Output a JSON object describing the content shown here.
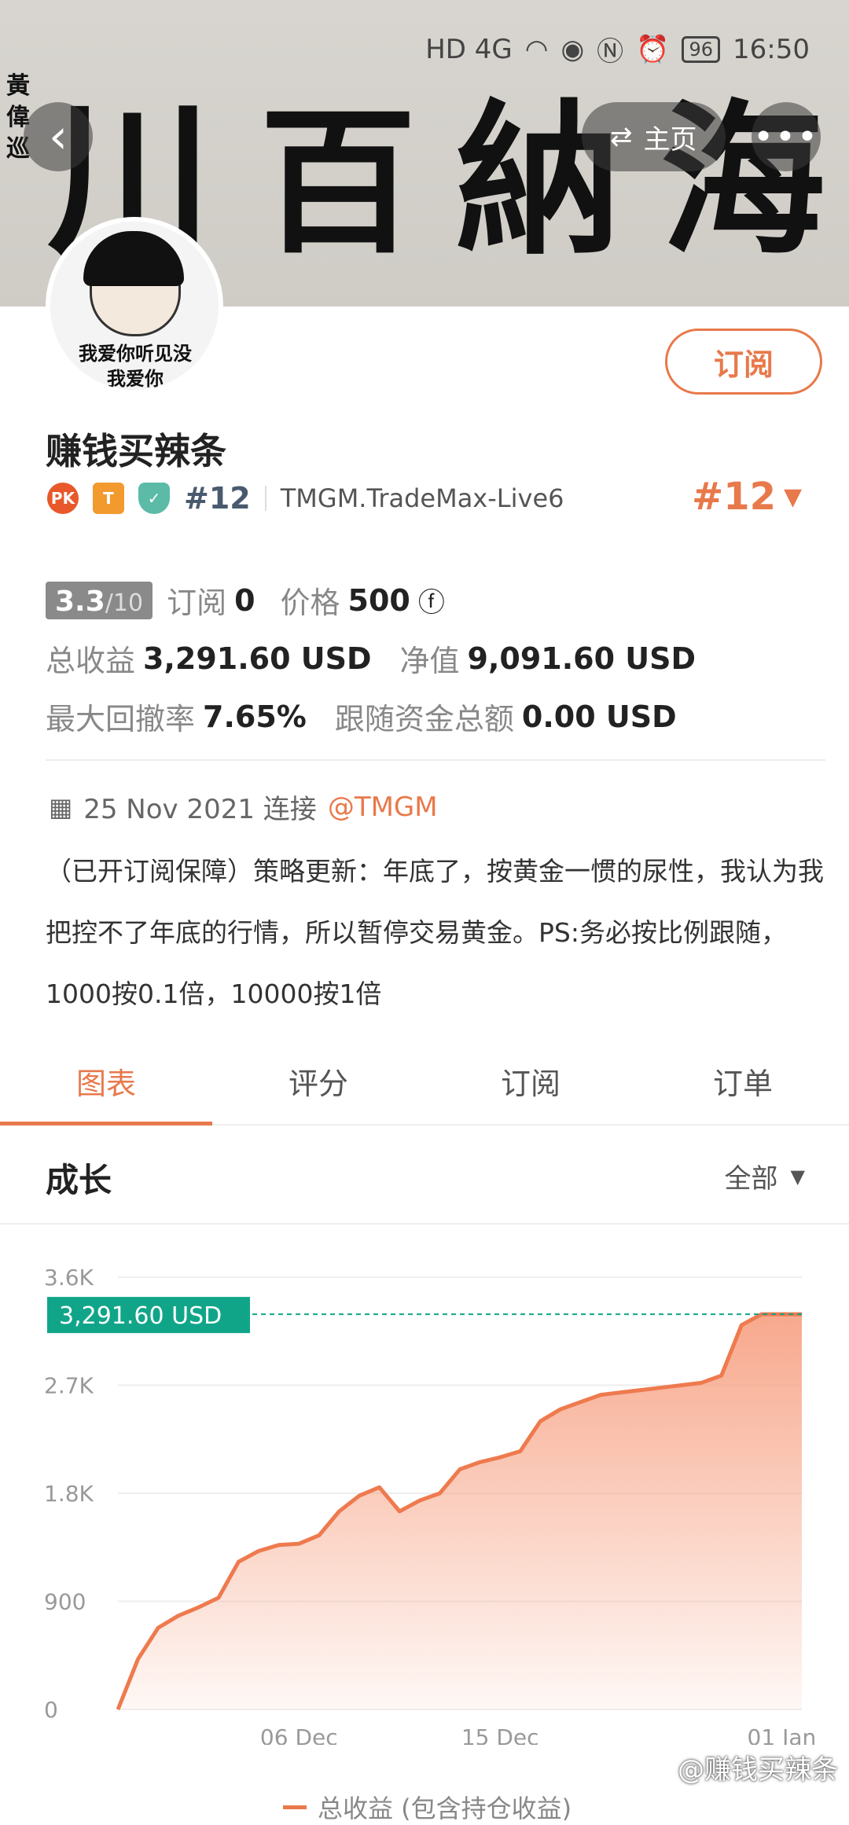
{
  "status_bar": {
    "network": "HD 4G",
    "battery": "96",
    "time": "16:50"
  },
  "header": {
    "home_label": "主页",
    "banner_chars": [
      "川",
      "百",
      "納",
      "海"
    ],
    "banner_seal": "黃偉巡"
  },
  "avatar": {
    "caption_line1": "我爱你听见没",
    "caption_line2": "我爱你"
  },
  "profile": {
    "subscribe_label": "订阅",
    "name": "赚钱买辣条",
    "rank": "#12",
    "server": "TMGM.TradeMax-Live6",
    "badges": [
      "PK",
      "T"
    ]
  },
  "stats": {
    "score": "3.3",
    "score_max": "/10",
    "subscribers_label": "订阅",
    "subscribers": "0",
    "price_label": "价格",
    "price": "500",
    "profit_label": "总收益",
    "profit": "3,291.60 USD",
    "equity_label": "净值",
    "equity": "9,091.60 USD",
    "drawdown_label": "最大回撤率",
    "drawdown": "7.65%",
    "follow_label": "跟随资金总额",
    "follow": "0.00 USD"
  },
  "info": {
    "date": "25 Nov 2021 连接",
    "broker_tag": "@TMGM",
    "description": "（已开订阅保障）策略更新：年底了，按黄金一惯的尿性，我认为我把控不了年底的行情，所以暂停交易黄金。PS:务必按比例跟随，1000按0.1倍，10000按1倍"
  },
  "tabs": [
    {
      "label": "图表",
      "active": true
    },
    {
      "label": "评分",
      "active": false
    },
    {
      "label": "订阅",
      "active": false
    },
    {
      "label": "订单",
      "active": false
    }
  ],
  "section": {
    "title": "成长",
    "range": "全部"
  },
  "chart_data": {
    "type": "area",
    "current_label": "3,291.60 USD",
    "x_ticks": [
      "06 Dec",
      "15 Dec",
      "01 Jan"
    ],
    "y_ticks": [
      "0",
      "900",
      "1.8K",
      "2.7K",
      "3.6K"
    ],
    "ylim": [
      0,
      3600
    ],
    "series": [
      {
        "name": "总收益 (包含持仓收益)",
        "x_index": [
          0,
          1,
          2,
          3,
          4,
          5,
          6,
          7,
          8,
          9,
          10,
          11,
          12,
          13,
          14,
          15,
          16,
          17,
          18,
          19,
          20,
          21,
          22,
          23,
          24,
          25,
          26,
          27,
          28,
          29,
          30,
          31,
          32,
          33,
          34
        ],
        "values": [
          0,
          420,
          680,
          780,
          850,
          930,
          1230,
          1320,
          1370,
          1380,
          1450,
          1650,
          1780,
          1850,
          1650,
          1740,
          1800,
          2000,
          2060,
          2100,
          2150,
          2400,
          2500,
          2560,
          2620,
          2640,
          2660,
          2680,
          2700,
          2720,
          2780,
          3200,
          3291.6,
          3291.6,
          3291.6
        ]
      }
    ],
    "colors": {
      "line": "#ee7a4e",
      "fill_top": "#f7a487",
      "label_bg": "#10a589",
      "dash": "#10a589"
    }
  },
  "legend": {
    "label": "总收益 (包含持仓收益)"
  },
  "watermark": "@赚钱买辣条"
}
